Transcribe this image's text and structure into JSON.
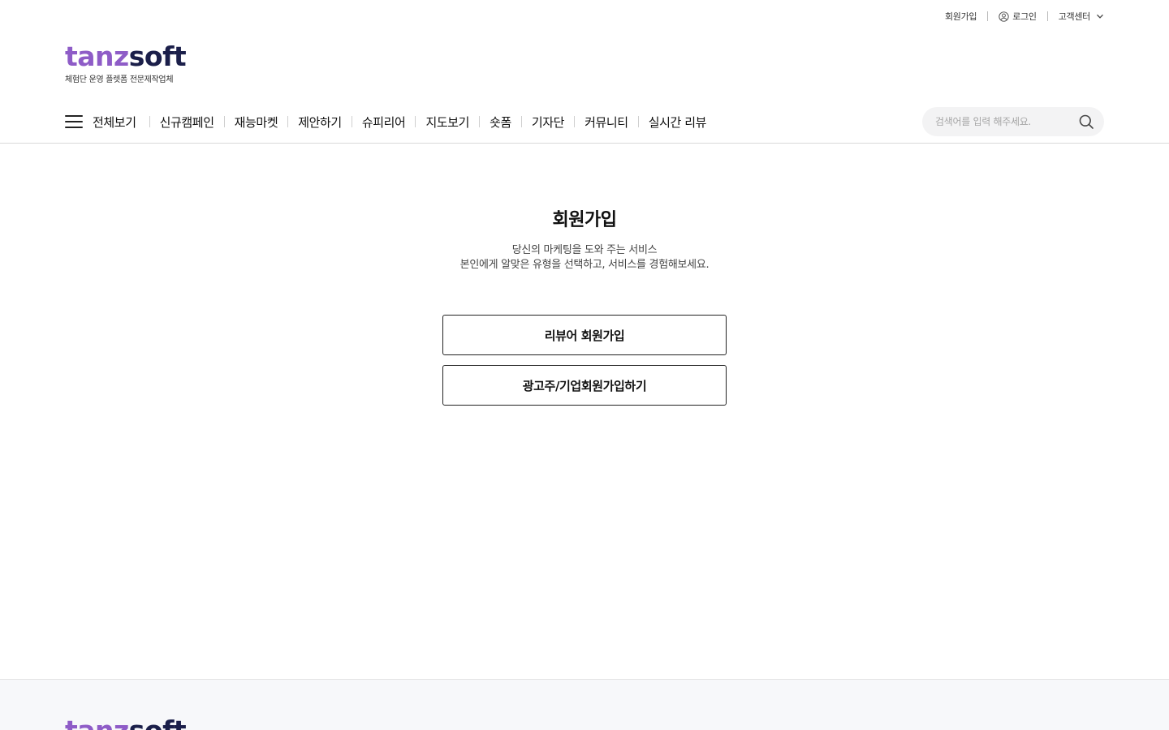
{
  "top_links": {
    "signup": "회원가입",
    "login": "로그인",
    "support": "고객센터"
  },
  "logo": {
    "word_a": "tanz",
    "word_b": "soft",
    "tagline": "체험단 운영 플렛폼 전문제작업체"
  },
  "nav": {
    "all_label": "전체보기",
    "items": [
      "신규캠페인",
      "재능마켓",
      "제안하기",
      "슈피리어",
      "지도보기",
      "숏폼",
      "기자단",
      "커뮤니티",
      "실시간 리뷰"
    ]
  },
  "search": {
    "placeholder": "검색어를 입력 해주세요."
  },
  "main": {
    "title": "회원가입",
    "desc_line1": "당신의 마케팅을 도와 주는 서비스",
    "desc_line2": "본인에게 알맞은 유형을 선택하고, 서비스를 경험해보세요.",
    "btn_reviewer": "리뷰어 회원가입",
    "btn_advertiser": "광고주/기업회원가입하기"
  },
  "colors": {
    "logo_accent": "#8e5cc7",
    "logo_dark": "#1b1f4a"
  }
}
